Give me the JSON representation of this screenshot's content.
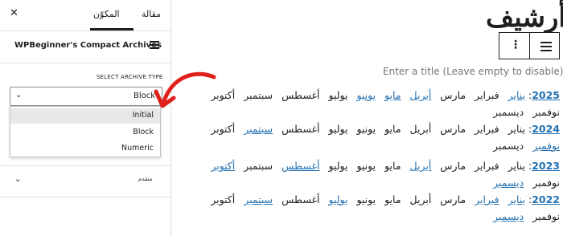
{
  "panel": {
    "tabs": {
      "post": "مقالة",
      "block": "المكوّن"
    },
    "block_name": "WPBeginner's Compact Archives",
    "select_label": "SELECT ARCHIVE TYPE",
    "select_value": "Block",
    "options": [
      "Initial",
      "Block",
      "Numeric"
    ],
    "advanced_label": "متقدم"
  },
  "editor": {
    "heading": "أرشيف",
    "title_placeholder": "Enter a title (Leave empty to disable)",
    "archives": [
      {
        "year": "2025",
        "months": [
          "يناير",
          "فبراير",
          "مارس",
          "أبريل",
          "مايو",
          "يونيو",
          "يوليو",
          "أغسطس",
          "سبتمبر",
          "أكتوبر",
          "نوفمبر",
          "ديسمبر"
        ],
        "linked": [
          true,
          false,
          false,
          true,
          true,
          true,
          false,
          false,
          false,
          false,
          false,
          false
        ]
      },
      {
        "year": "2024",
        "months": [
          "يناير",
          "فبراير",
          "مارس",
          "أبريل",
          "مايو",
          "يونيو",
          "يوليو",
          "أغسطس",
          "سبتمبر",
          "أكتوبر",
          "نوفمبر",
          "ديسمبر"
        ],
        "linked": [
          false,
          false,
          false,
          false,
          false,
          false,
          false,
          false,
          true,
          false,
          true,
          false
        ]
      },
      {
        "year": "2023",
        "months": [
          "يناير",
          "فبراير",
          "مارس",
          "أبريل",
          "مايو",
          "يونيو",
          "يوليو",
          "أغسطس",
          "سبتمبر",
          "أكتوبر",
          "نوفمبر",
          "ديسمبر"
        ],
        "linked": [
          false,
          false,
          false,
          true,
          false,
          false,
          false,
          true,
          false,
          true,
          false,
          true
        ]
      },
      {
        "year": "2022",
        "months": [
          "يناير",
          "فبراير",
          "مارس",
          "أبريل",
          "مايو",
          "يونيو",
          "يوليو",
          "أغسطس",
          "سبتمبر",
          "أكتوبر",
          "نوفمبر",
          "ديسمبر"
        ],
        "linked": [
          true,
          true,
          false,
          false,
          false,
          false,
          true,
          false,
          true,
          false,
          false,
          true
        ]
      }
    ]
  },
  "colors": {
    "link": "#2271b1",
    "arrow": "#e0201b",
    "text": "#1e1e1e"
  }
}
